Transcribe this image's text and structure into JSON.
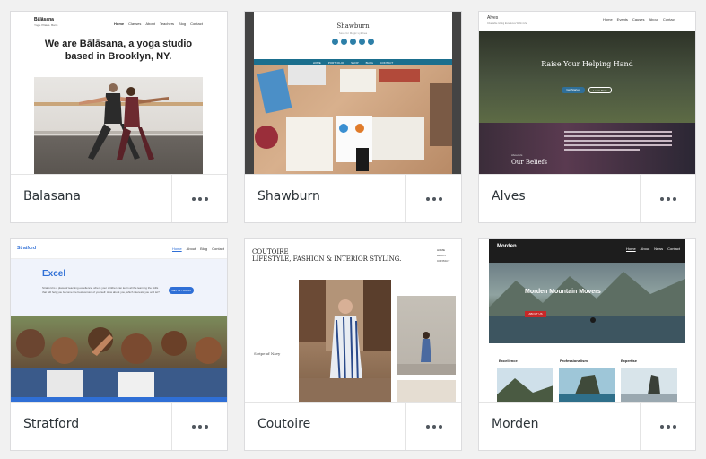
{
  "themes": [
    {
      "name": "Balasana",
      "preview": {
        "logo": "Bālāsana",
        "tagline": "Yoga. Pilates. Barre",
        "nav": [
          "Home",
          "Classes",
          "About",
          "Teachers",
          "Blog",
          "Contact"
        ],
        "headline_line1": "We are Bālāsana, a yoga studio",
        "headline_line2": "based in Brooklyn, NY."
      }
    },
    {
      "name": "Shawburn",
      "preview": {
        "title": "Shawburn",
        "subtitle": "Save for Magic Lyfebea",
        "nav": [
          "HOME",
          "PORTFOLIO",
          "SHOP",
          "BLOG",
          "CONTACT"
        ]
      }
    },
    {
      "name": "Alves",
      "preview": {
        "logo": "Alves",
        "tagline": "Charitable Giving Excellence Within Life",
        "nav": [
          "Home",
          "Events",
          "Causes",
          "About",
          "Contact"
        ],
        "hero_title": "Raise Your Helping Hand",
        "button1": "Get Started",
        "button2": "Learn More",
        "section_label": "About Us",
        "section_title": "Our Beliefs"
      }
    },
    {
      "name": "Stratford",
      "preview": {
        "logo": "Stratford",
        "nav": [
          "Home",
          "About",
          "Blog",
          "Contact"
        ],
        "headline": "Excel",
        "body": "Stratford is a place of teaching excellence, where your children can learn all the learning the skills that will help you become the best version of yourself. How about you, which interests you and let?",
        "button": "GET IN TOUCH"
      }
    },
    {
      "name": "Coutoire",
      "preview": {
        "logo": "COUTOIRE",
        "headline": "LIFESTYLE, FASHION & INTERIOR STYLING.",
        "nav": [
          "HOME",
          "ABOUT",
          "CONTACT"
        ],
        "sidebar_title": "Stripe of Navy"
      }
    },
    {
      "name": "Morden",
      "preview": {
        "logo": "Morden",
        "nav": [
          "Home",
          "About",
          "News",
          "Contact"
        ],
        "hero_title": "Morden Mountain Movers",
        "button": "ABOUT US",
        "columns": [
          "Excellence",
          "Professionalism",
          "Expertise"
        ]
      }
    }
  ]
}
